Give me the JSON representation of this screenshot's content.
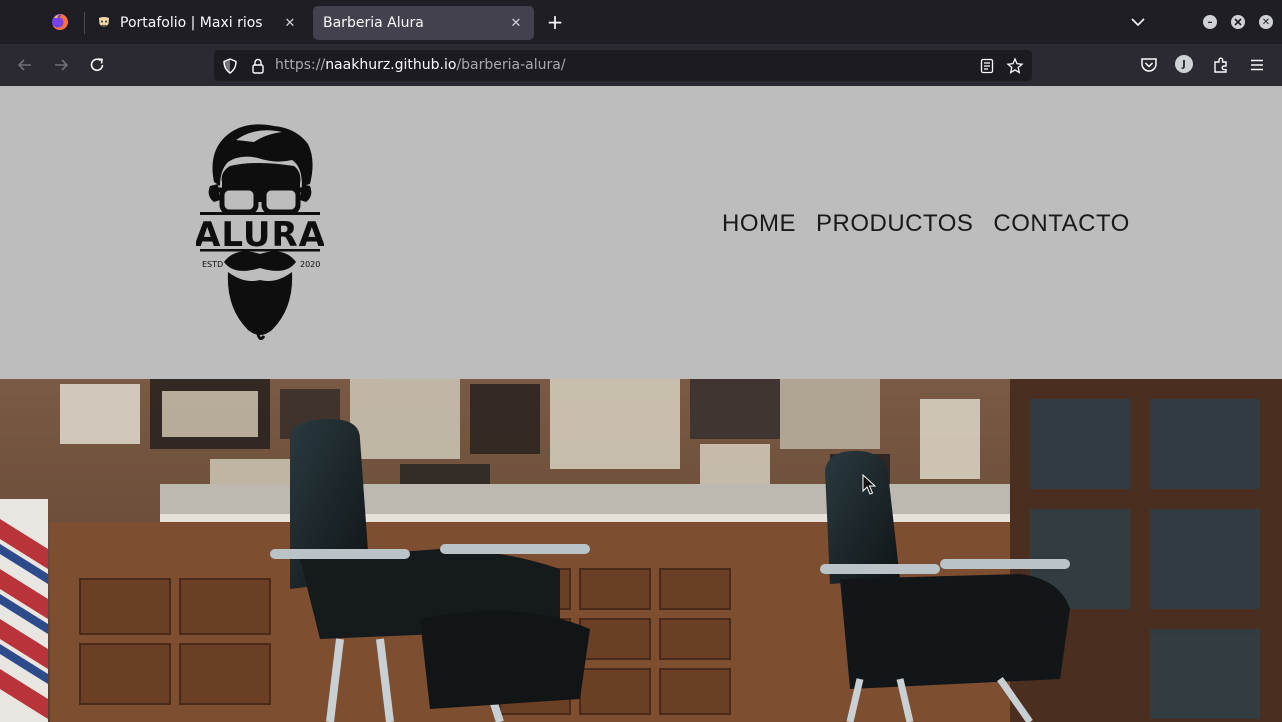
{
  "browser": {
    "tabs": [
      {
        "title": "Portafolio | Maxi rios",
        "favicon": "mask-icon",
        "active": false
      },
      {
        "title": "Barberia Alura",
        "favicon": "none",
        "active": true
      }
    ],
    "url": {
      "scheme": "https://",
      "host": "naakhurz.github.io",
      "path": "/barberia-alura/"
    },
    "profile_initial": "J"
  },
  "site": {
    "logo": {
      "brand": "ALURA",
      "left_text": "ESTD",
      "right_text": "2020"
    },
    "nav": [
      {
        "label": "HOME"
      },
      {
        "label": "PRODUCTOS"
      },
      {
        "label": "CONTACTO"
      }
    ],
    "hero_image": "barbershop-interior-photo"
  },
  "colors": {
    "tabbar_bg": "#1f1e25",
    "toolbar_bg": "#2b2a33",
    "urlbar_bg": "#1c1b22",
    "header_bg": "#bdbdbd",
    "nav_text": "#1a1a1a"
  }
}
